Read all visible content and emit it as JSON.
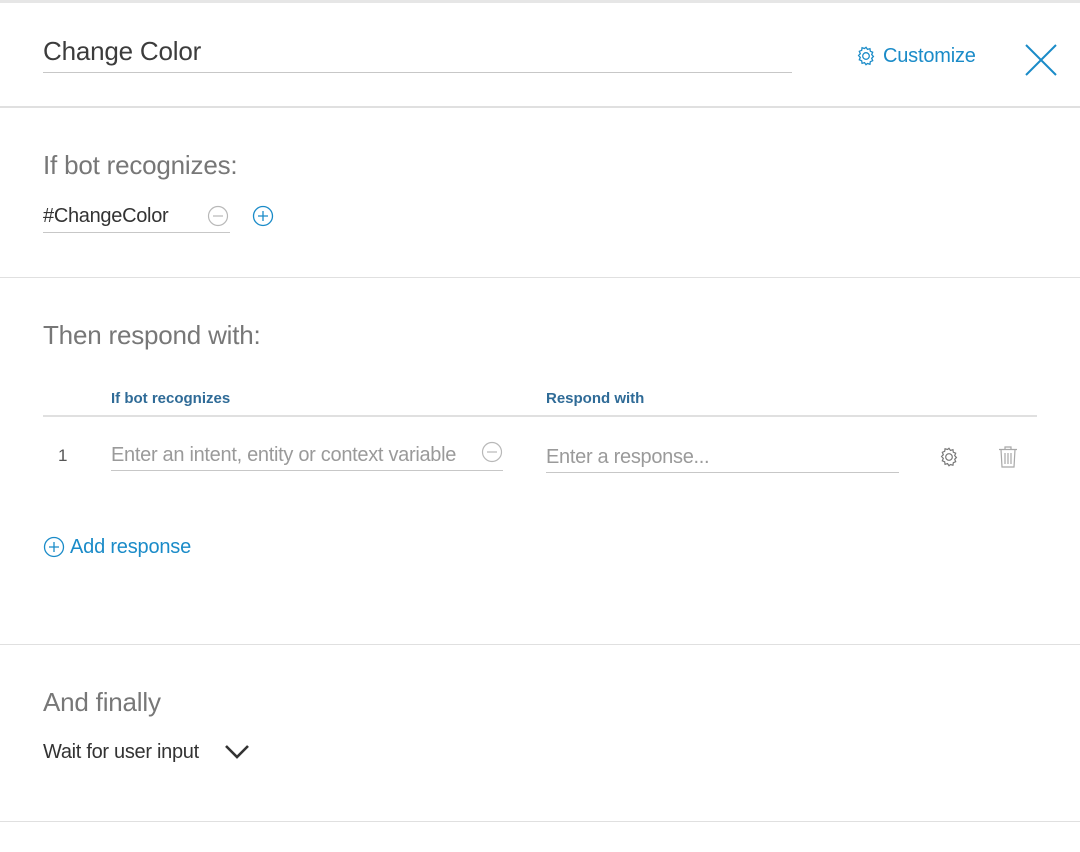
{
  "header": {
    "title": "Change Color",
    "customize_label": "Customize",
    "customize_icon": "gear-icon",
    "close_icon": "close-icon"
  },
  "if_section": {
    "heading": "If bot recognizes:",
    "condition_value": "#ChangeColor",
    "remove_icon": "minus-circle-icon",
    "add_icon": "plus-circle-icon"
  },
  "then_section": {
    "heading": "Then respond with:",
    "columns": [
      "If bot recognizes",
      "Respond with"
    ],
    "rows": [
      {
        "number": "1",
        "condition_placeholder": "Enter an intent, entity or context variable",
        "response_placeholder": "Enter a response..."
      }
    ],
    "add_response_label": "Add response"
  },
  "finally_section": {
    "heading": "And finally",
    "selected_option": "Wait for user input"
  },
  "colors": {
    "accent": "#1a8bc8",
    "column_header": "#2f6b97",
    "heading": "#777777",
    "divider": "#e0e0e0"
  }
}
